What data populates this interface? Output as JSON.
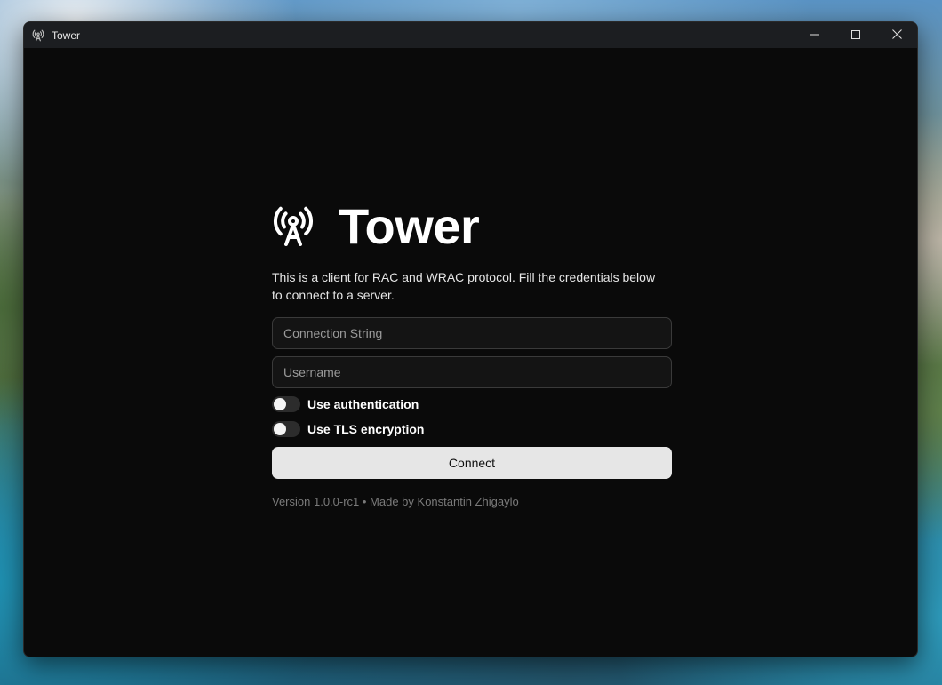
{
  "window": {
    "title": "Tower",
    "controls": {
      "minimize_icon": "minimize-icon",
      "maximize_icon": "maximize-icon",
      "close_icon": "close-icon"
    }
  },
  "app": {
    "brand_title": "Tower",
    "brand_icon": "broadcast-tower-icon",
    "description": "This is a client for RAC and WRAC protocol. Fill the credentials below to connect to a server.",
    "form": {
      "connection_string": {
        "value": "",
        "placeholder": "Connection String"
      },
      "username": {
        "value": "",
        "placeholder": "Username"
      },
      "toggles": [
        {
          "label": "Use authentication",
          "checked": false
        },
        {
          "label": "Use TLS encryption",
          "checked": false
        }
      ],
      "connect_label": "Connect"
    },
    "footer": "Version 1.0.0-rc1 • Made by Konstantin Zhigaylo"
  },
  "colors": {
    "window_bg": "#0a0a0a",
    "titlebar_bg": "#1c1e21",
    "button_bg": "#e6e6e6",
    "input_bg": "#141414",
    "muted_text": "#7a7a7a"
  }
}
